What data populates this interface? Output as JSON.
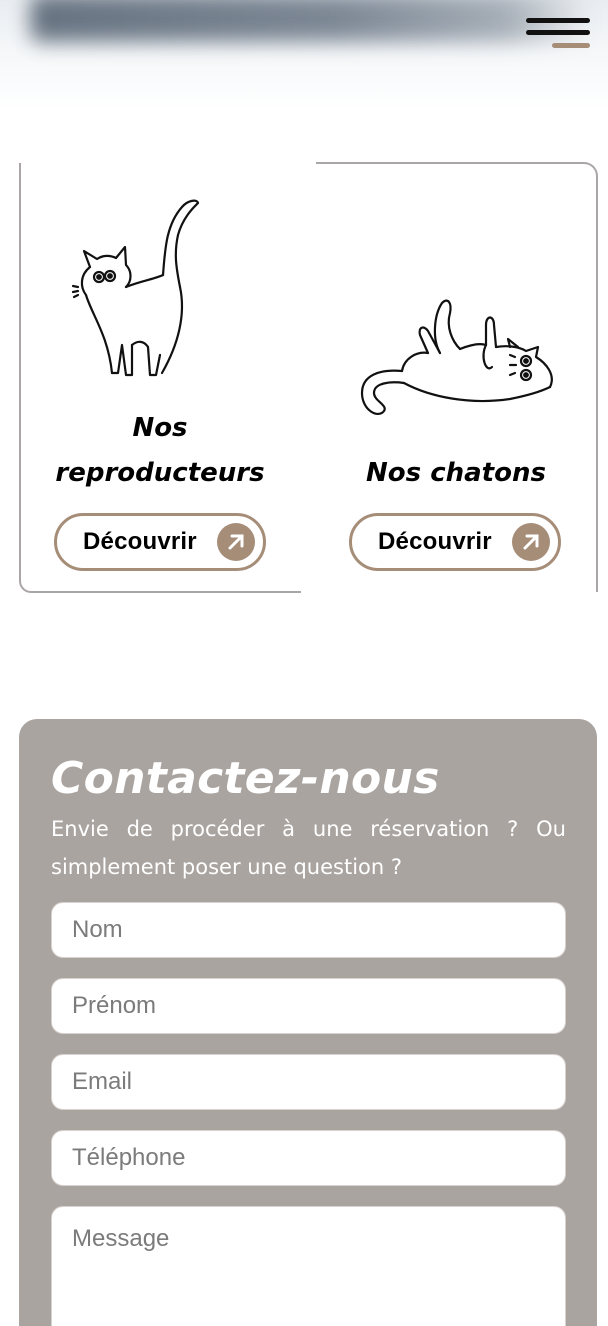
{
  "header": {
    "menu_icon": "hamburger-icon"
  },
  "cards": [
    {
      "title_line1": "Nos",
      "title_line2": "reproducteurs",
      "button_label": "Découvrir",
      "icon": "arrow-up-right-icon"
    },
    {
      "title": "Nos chatons",
      "button_label": "Découvrir",
      "icon": "arrow-up-right-icon"
    }
  ],
  "contact": {
    "title": "Contactez-nous",
    "subtitle": "Envie de procéder à une réservation ? Ou simplement poser une question ?",
    "fields": {
      "nom": {
        "placeholder": "Nom",
        "value": ""
      },
      "prenom": {
        "placeholder": "Prénom",
        "value": ""
      },
      "email": {
        "placeholder": "Email",
        "value": ""
      },
      "telephone": {
        "placeholder": "Téléphone",
        "value": ""
      },
      "message": {
        "placeholder": "Message",
        "value": ""
      }
    }
  },
  "colors": {
    "accent": "#a68d78",
    "contact_bg": "#aaa4a0",
    "border": "#aaa6a6"
  }
}
